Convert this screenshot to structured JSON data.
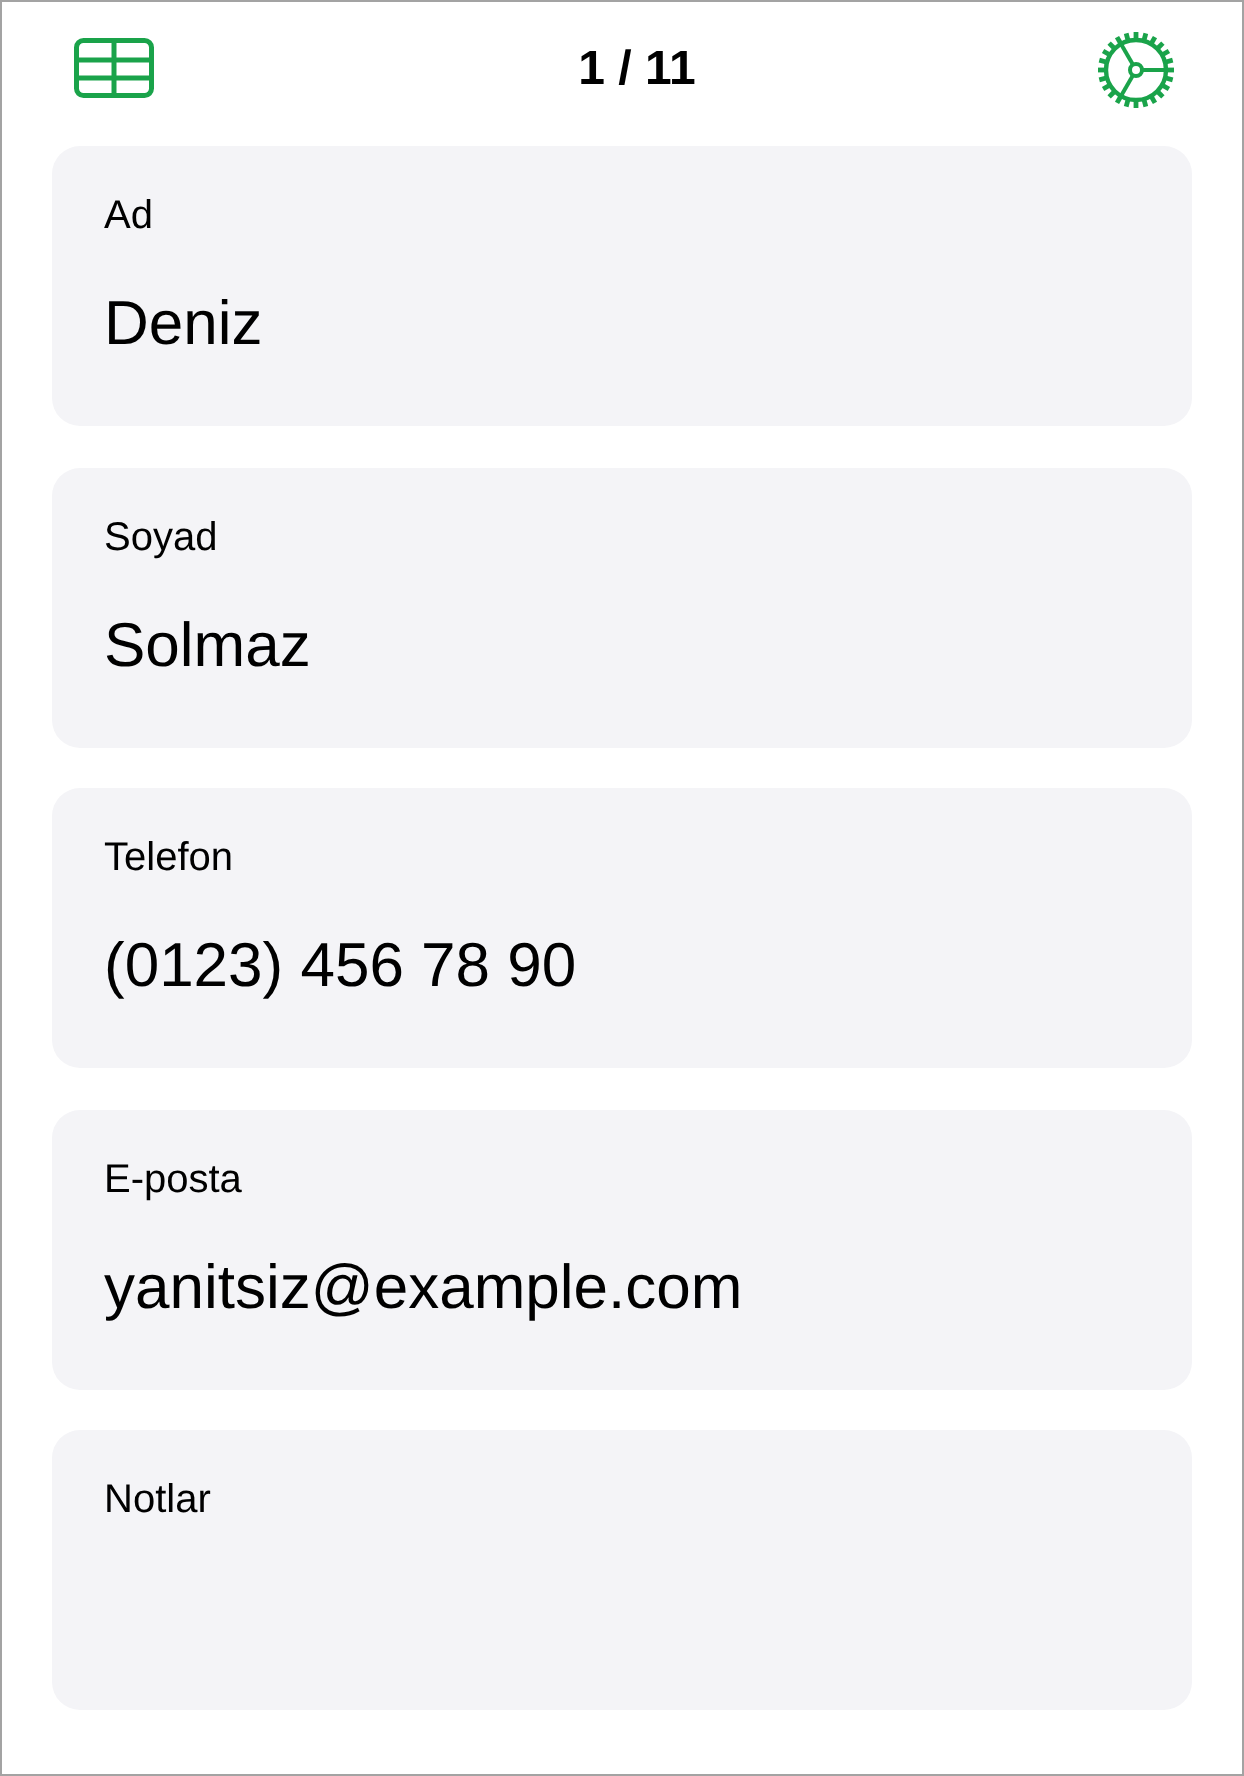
{
  "header": {
    "title": "1 / 11"
  },
  "fields": [
    {
      "label": "Ad",
      "value": "Deniz"
    },
    {
      "label": "Soyad",
      "value": "Solmaz"
    },
    {
      "label": "Telefon",
      "value": "(0123) 456 78 90"
    },
    {
      "label": "E-posta",
      "value": "yanitsiz@example.com"
    },
    {
      "label": "Notlar"
    }
  ]
}
